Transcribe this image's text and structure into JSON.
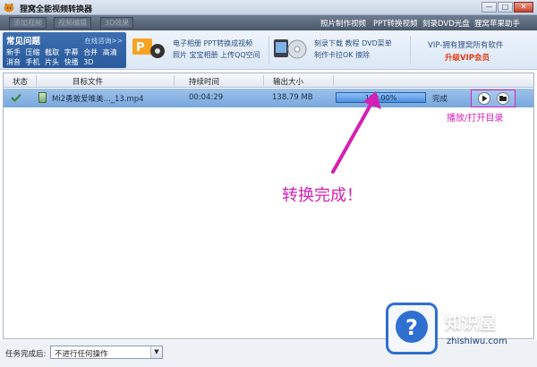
{
  "app": {
    "title": "狸窝全能视频转换器"
  },
  "window_controls": [
    "—",
    "□",
    "✕"
  ],
  "toolbar": {
    "left_buttons": [
      "添加视频",
      "视频编辑",
      "3D效果"
    ],
    "right_links": [
      "照片制作视频",
      "PPT转换视频",
      "刻录DVD光盘",
      "狸窝苹果助手"
    ]
  },
  "banner": {
    "faq_title": "常见问题",
    "faq_online": "在线咨询>>",
    "faq_row1": [
      "新手",
      "压缩",
      "截取",
      "字幕",
      "合并",
      "高清"
    ],
    "faq_row2": [
      "消音",
      "手机",
      "片头",
      "快播",
      "3D"
    ],
    "ad1_line1": "电子相册  PPT转换成视频",
    "ad1_line2": "照片  宝宝相册  上传QQ空间",
    "ad2_line1": "刻录下载  教程  DVD菜单",
    "ad2_line2": "制作卡拉OK  擦除",
    "vip_line1": "VIP-拥有狸窝所有软件",
    "vip_line2": "升级VIP会员"
  },
  "table": {
    "headers": [
      "状态",
      "目标文件",
      "持续时间",
      "输出大小"
    ],
    "rows": [
      {
        "file": "Mi2勇敢爱唯美..._13.mp4",
        "duration": "00:04:29",
        "size": "138.79 MB",
        "progress_label": "100.00%",
        "progress": 1.0,
        "status": "完成"
      }
    ]
  },
  "annotations": {
    "action_label": "播放/打开目录",
    "main_label": "转换完成！"
  },
  "footer": {
    "label": "任务完成后:",
    "select_value": "不进行任何操作"
  },
  "watermark": {
    "title": "知识屋",
    "subtitle": "zhishiwu.com"
  },
  "colors": {
    "selection_row": "#8ab5e4",
    "annotation": "#d41fb5",
    "vip_red": "#e03a10",
    "watermark_blue": "#2f6fd0"
  }
}
